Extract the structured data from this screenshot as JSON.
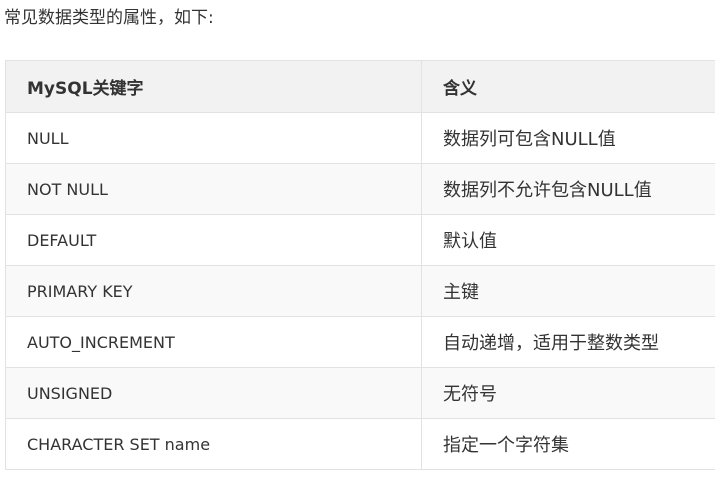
{
  "intro": "常见数据类型的属性，如下:",
  "table": {
    "headers": [
      "MySQL关键字",
      "含义"
    ],
    "rows": [
      [
        "NULL",
        "数据列可包含NULL值"
      ],
      [
        "NOT NULL",
        "数据列不允许包含NULL值"
      ],
      [
        "DEFAULT",
        "默认值"
      ],
      [
        "PRIMARY KEY",
        "主键"
      ],
      [
        "AUTO_INCREMENT",
        "自动递增，适用于整数类型"
      ],
      [
        "UNSIGNED",
        "无符号"
      ],
      [
        "CHARACTER SET name",
        "指定一个字符集"
      ]
    ]
  }
}
